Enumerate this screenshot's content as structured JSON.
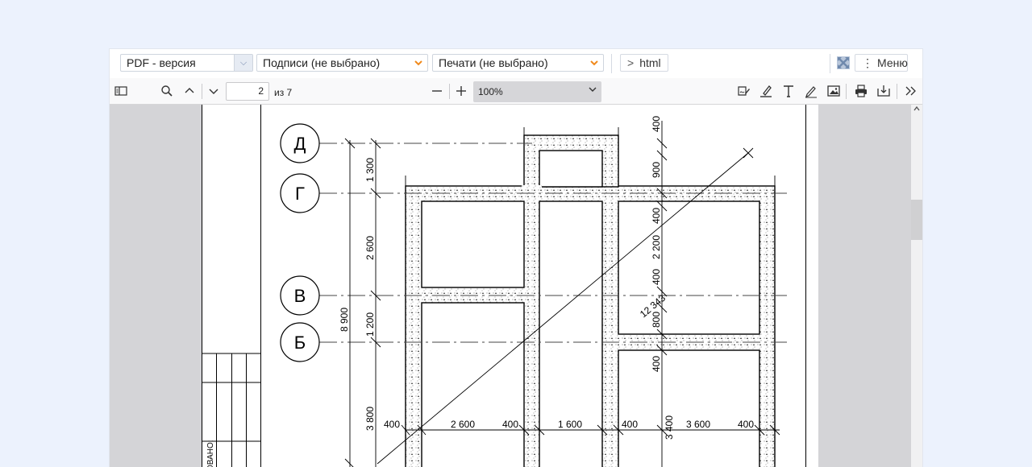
{
  "toolbar": {
    "version_select": "PDF - версия",
    "signatures_select": "Подписи (не выбрано)",
    "stamps_select": "Печати (не выбрано)",
    "html_button": "html",
    "html_chevron": ">",
    "menu_button": "Меню",
    "menu_dots": "⋮",
    "colors": {
      "dropdown_arrow_orange": "#f08a1c",
      "dropdown_arrow_blue": "#6a7fa6",
      "fullscreen_icon": "#7f9bbf"
    }
  },
  "viewer_toolbar": {
    "page_number": "2",
    "page_count": "из 7",
    "zoom": "100%"
  },
  "drawing": {
    "axes": [
      "Д",
      "Г",
      "В",
      "Б"
    ],
    "vertical_dims_outer": [
      "1 300",
      "2 600",
      "1 200",
      "3 800"
    ],
    "total_height": "8 900",
    "diagonal": "12 343",
    "right_dims": [
      "400",
      "900",
      "400",
      "2 200",
      "400",
      "800",
      "400",
      "3 400"
    ],
    "bottom_dims": [
      "400",
      "2 600",
      "400",
      "1 600",
      "400",
      "3 600",
      "400"
    ],
    "stamp_text": "ОВАНО:"
  }
}
